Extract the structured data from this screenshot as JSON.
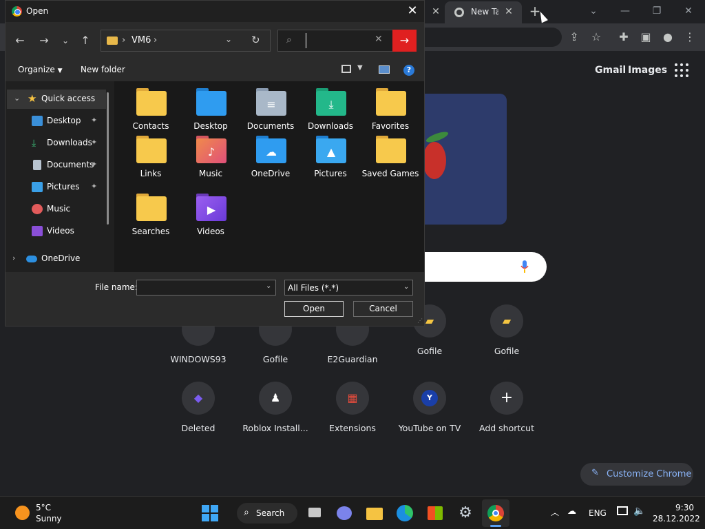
{
  "chrome": {
    "active_tab_title": "New Tab",
    "gmail": "Gmail",
    "images": "Images",
    "shortcuts": [
      {
        "label": "WINDOWS93"
      },
      {
        "label": "Gofile"
      },
      {
        "label": "E2Guardian"
      },
      {
        "label": "Gofile"
      },
      {
        "label": "Gofile"
      },
      {
        "label": "Deleted"
      },
      {
        "label": "Roblox Install..."
      },
      {
        "label": "Extensions"
      },
      {
        "label": "YouTube on TV",
        "glyph": "Y"
      },
      {
        "label": "Add shortcut",
        "glyph": "+"
      }
    ],
    "customize": "Customize Chrome"
  },
  "dialog": {
    "title": "Open",
    "address": {
      "path": "VM6"
    },
    "search": {
      "value": ""
    },
    "commands": {
      "organize": "Organize",
      "new_folder": "New folder"
    },
    "nav_items": [
      {
        "label": "Quick access"
      },
      {
        "label": "Desktop"
      },
      {
        "label": "Downloads"
      },
      {
        "label": "Documents"
      },
      {
        "label": "Pictures"
      },
      {
        "label": "Music"
      },
      {
        "label": "Videos"
      },
      {
        "label": "OneDrive"
      }
    ],
    "files": [
      {
        "label": "Contacts"
      },
      {
        "label": "Desktop"
      },
      {
        "label": "Documents"
      },
      {
        "label": "Downloads"
      },
      {
        "label": "Favorites"
      },
      {
        "label": "Links"
      },
      {
        "label": "Music"
      },
      {
        "label": "OneDrive"
      },
      {
        "label": "Pictures"
      },
      {
        "label": "Saved Games"
      },
      {
        "label": "Searches"
      },
      {
        "label": "Videos"
      }
    ],
    "footer": {
      "file_name_label": "File name:",
      "file_name_value": "",
      "filter": "All Files (*.*)",
      "open": "Open",
      "cancel": "Cancel"
    }
  },
  "taskbar": {
    "weather_temp": "5°C",
    "weather_cond": "Sunny",
    "search": "Search",
    "language": "ENG",
    "time": "9:30",
    "date": "28.12.2022"
  }
}
